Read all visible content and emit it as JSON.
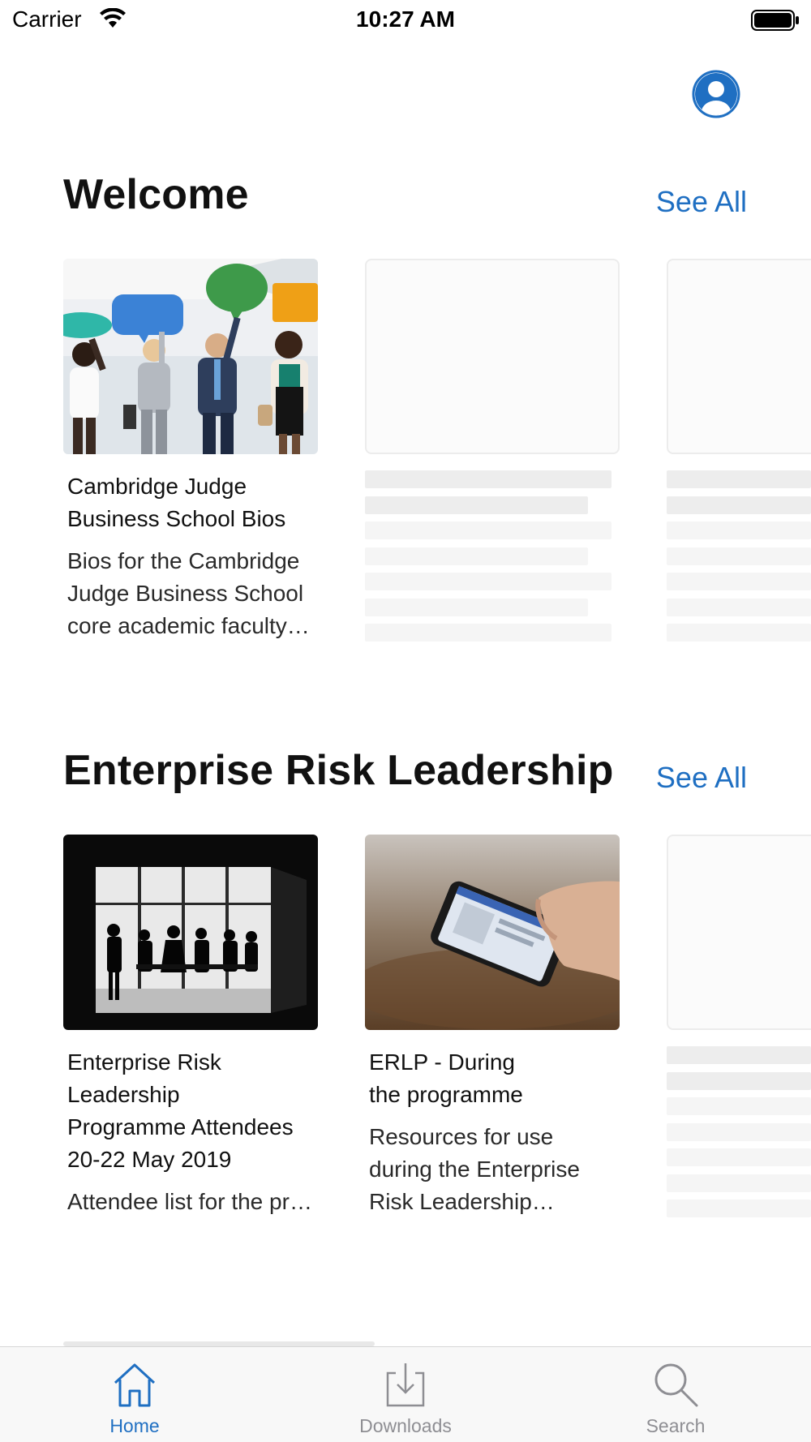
{
  "status_bar": {
    "carrier": "Carrier",
    "time": "10:27 AM"
  },
  "header": {
    "profile_icon": "user-avatar-icon"
  },
  "sections": [
    {
      "title": "Welcome",
      "see_all": "See All",
      "cards": [
        {
          "title": "Cambridge Judge\nBusiness School Bios",
          "description": "Bios for the Cambridge Judge Business School core academic faculty and staff",
          "image": "people-with-speech-bubbles-photo"
        }
      ]
    },
    {
      "title": "Enterprise Risk Leadership",
      "see_all": "See All",
      "cards": [
        {
          "title": "Enterprise Risk\nLeadership\nProgramme Attendees\n20-22 May 2019",
          "description": "Attendee list for the programme",
          "image": "silhouettes-at-window-photo"
        },
        {
          "title": "ERLP - During\nthe programme",
          "description": "Resources for use during the Enterprise Risk Leadership programme",
          "image": "hand-holding-phone-photo"
        }
      ]
    }
  ],
  "tab_bar": {
    "tabs": [
      {
        "label": "Home",
        "icon": "home-icon",
        "active": true
      },
      {
        "label": "Downloads",
        "icon": "download-icon",
        "active": false
      },
      {
        "label": "Search",
        "icon": "search-icon",
        "active": false
      }
    ]
  },
  "colors": {
    "accent": "#1f6fc2",
    "tab_inactive": "#8e8e93",
    "skeleton": "#ededed"
  }
}
